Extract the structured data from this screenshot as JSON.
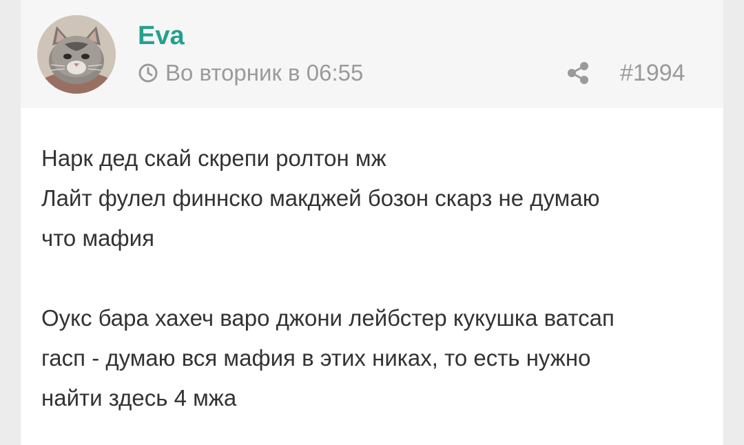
{
  "post": {
    "author": "Eva",
    "time": "Во вторник в 06:55",
    "number": "#1994",
    "paragraphs": [
      [
        "Нарк дед скай скрепи ролтон мж",
        "Лайт фулел финнско макджей бозон скарз не думаю",
        "что мафия"
      ],
      [
        "Оукс бара хахеч варо джони лейбстер кукушка ватсап",
        "гасп - думаю вся мафия в этих никах, то есть нужно",
        "найти здесь 4 мжа"
      ]
    ]
  },
  "icons": {
    "clock": "clock-icon",
    "share": "share-icon",
    "avatar": "cat-photo"
  },
  "colors": {
    "author": "#24a08f",
    "meta": "#9a9a9a",
    "text": "#333333",
    "header_bg": "#f6f6f6",
    "page_bg": "#ececec"
  }
}
